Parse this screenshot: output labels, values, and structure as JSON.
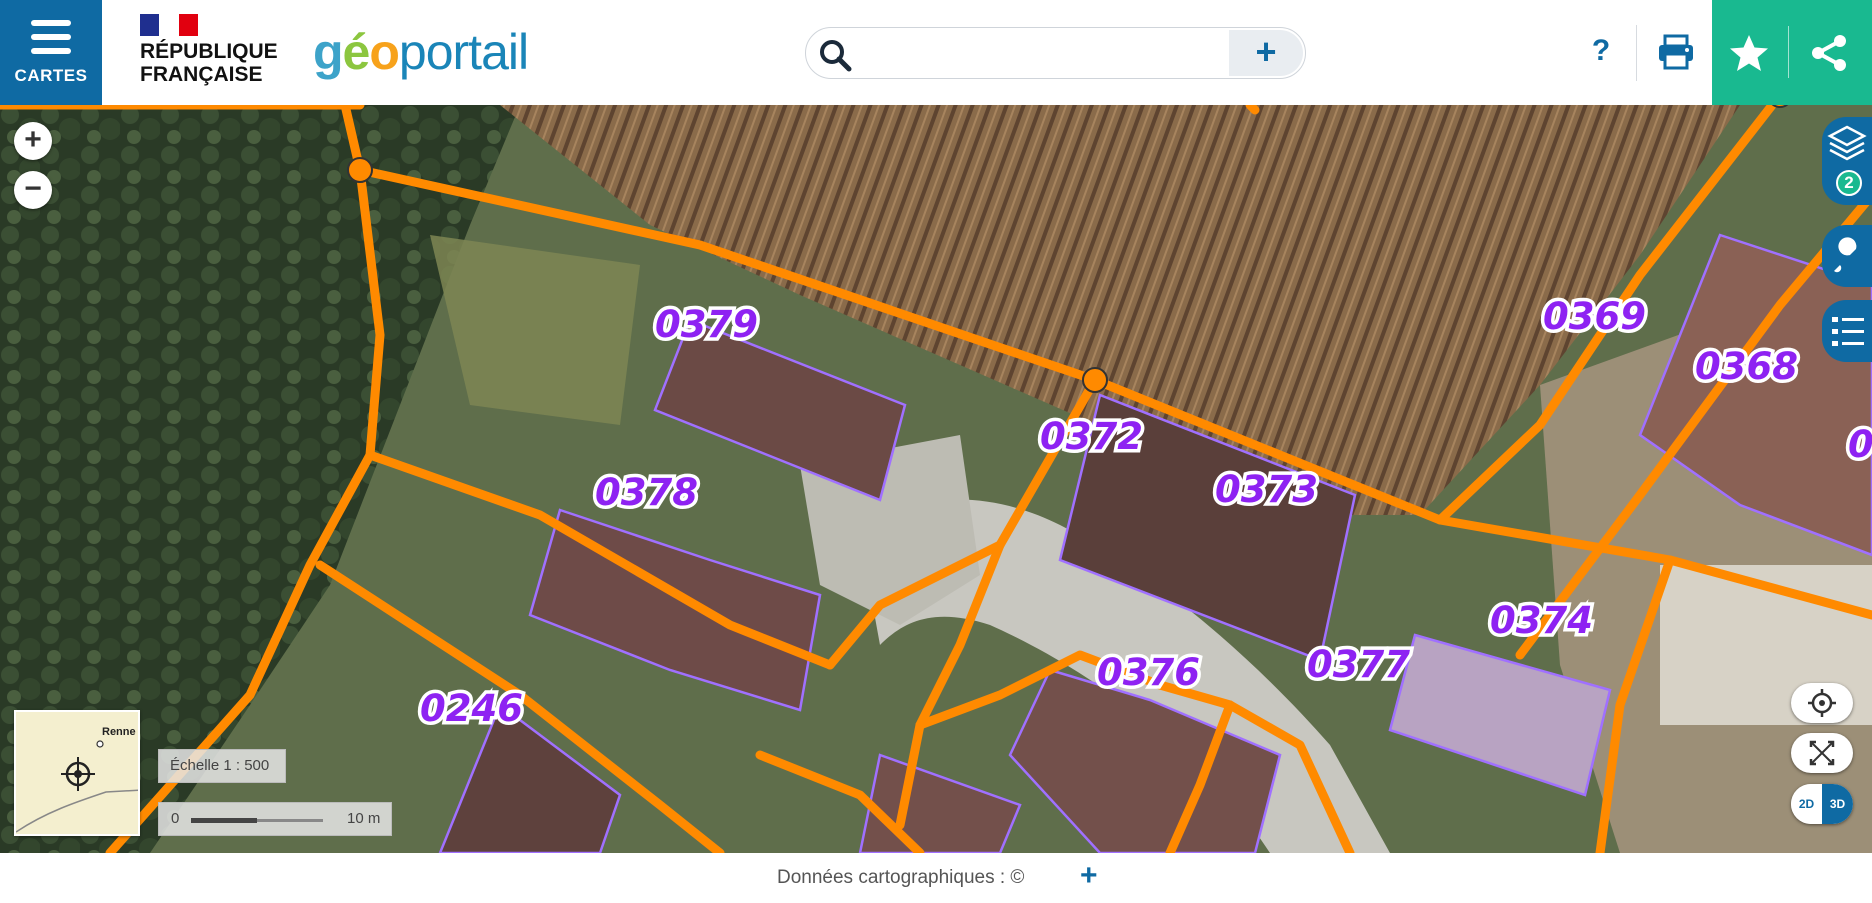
{
  "header": {
    "menu_label": "CARTES",
    "republic_line1": "RÉPUBLIQUE",
    "republic_line2": "FRANÇAISE",
    "brand_geo": [
      "g",
      "é",
      "o"
    ],
    "brand_portail": "portail",
    "search_placeholder": "",
    "search_plus": "+",
    "help_label": "?"
  },
  "map": {
    "layer_count": "2",
    "parcel_labels": [
      "0379",
      "0378",
      "0372",
      "0373",
      "0369",
      "0368",
      "0374",
      "0376",
      "0377",
      "0246",
      "0"
    ],
    "overview_place": "Renne",
    "scale_label": "Échelle 1 : 500",
    "scale_zero": "0",
    "scale_distance": "10 m",
    "view_2d": "2D",
    "view_3d": "3D"
  },
  "footer": {
    "credit": "Données cartographiques : ©",
    "plus": "+"
  },
  "colors": {
    "brand_blue": "#0f6aa3",
    "accent_green": "#19b990",
    "parcel_border": "#ff8a00",
    "building_outline": "#a070ff",
    "label_purple": "#8e22f2"
  }
}
